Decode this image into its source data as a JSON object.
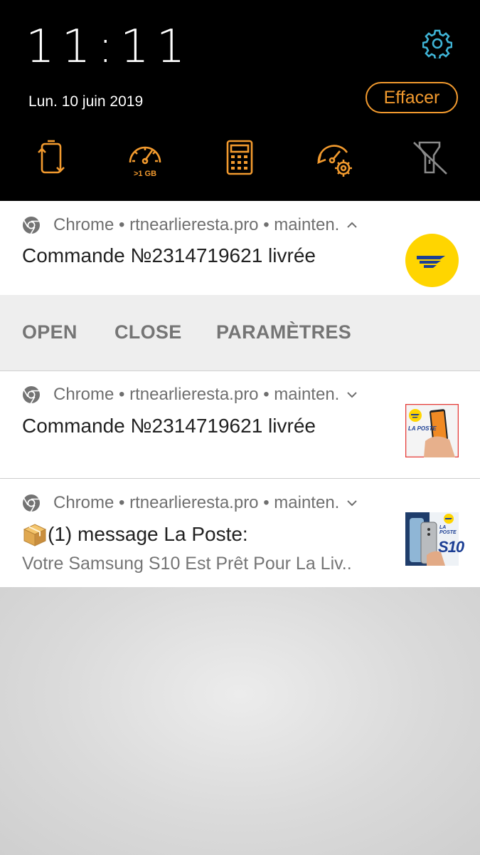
{
  "status": {
    "time": "11:11",
    "date": "Lun. 10 juin 2019",
    "clear_label": "Effacer"
  },
  "quick_settings": {
    "icons": [
      "auto-rotate-icon",
      "data-usage-icon",
      "calculator-icon",
      "performance-settings-icon",
      "flashlight-off-icon"
    ],
    "data_label": ">1 GB",
    "accent_color": "#f29a2e"
  },
  "notifications": [
    {
      "app": "Chrome",
      "source": "rtnearlieresta.pro",
      "channel": "mainten.",
      "title": "Commande №2314719621 livrée",
      "expanded": true,
      "actions": [
        "OPEN",
        "CLOSE",
        "PARAMÈTRES"
      ]
    },
    {
      "app": "Chrome",
      "source": "rtnearlieresta.pro",
      "channel": "mainten.",
      "title": "Commande №2314719621 livrée",
      "thumb_text": "LA POSTE"
    },
    {
      "app": "Chrome",
      "source": "rtnearlieresta.pro",
      "channel": "mainten.",
      "title": "(1) message La Poste:",
      "body": "Votre Samsung S10 Est Prêt Pour La Liv..",
      "thumb_text": "LA POSTE",
      "thumb_model": "S10"
    }
  ]
}
